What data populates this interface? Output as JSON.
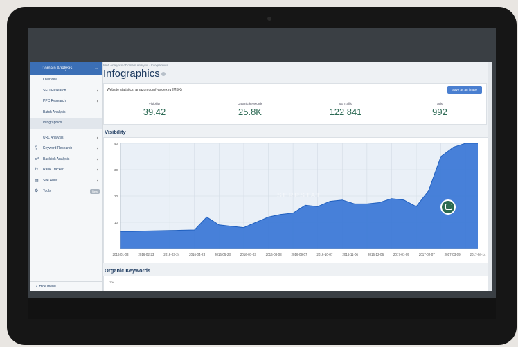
{
  "sidebar": {
    "header": "Domain Analysis",
    "items": [
      {
        "label": "Overview",
        "chevron": false,
        "active": false
      },
      {
        "label": "SEO Research",
        "chevron": true,
        "active": false
      },
      {
        "label": "PPC Research",
        "chevron": true,
        "active": false
      },
      {
        "label": "Batch Analysis",
        "chevron": false,
        "active": false
      },
      {
        "label": "Infographics",
        "chevron": false,
        "active": true
      }
    ],
    "tools": [
      {
        "label": "URL Analysis",
        "icon": "link-icon"
      },
      {
        "label": "Keyword Research",
        "icon": "key-icon"
      },
      {
        "label": "Backlink Analysis",
        "icon": "chain-icon"
      },
      {
        "label": "Rank Tracker",
        "icon": "refresh-icon"
      },
      {
        "label": "Site Audit",
        "icon": "chart-icon"
      },
      {
        "label": "Tools",
        "icon": "gear-icon",
        "badge": "New"
      }
    ],
    "hide_menu": "Hide menu"
  },
  "breadcrumb": "Web Analytics / Domain Analysis / Infographics",
  "page_title": "Infographics",
  "stats_panel": {
    "header": "Website statistics: amazon.com/yandex.ru (MSK)",
    "save_button": "Save as an image",
    "stats": [
      {
        "label": "Visibility",
        "value": "39.42"
      },
      {
        "label": "Organic keywords",
        "value": "25.8K"
      },
      {
        "label": "SE Traffic",
        "value": "122 841"
      },
      {
        "label": "Ads",
        "value": "992"
      }
    ]
  },
  "visibility_section": {
    "title": "Visibility"
  },
  "watermark": "SERPSTAT",
  "organic_section": {
    "title": "Organic Keywords",
    "tick": "70k"
  },
  "chart_data": {
    "type": "area",
    "x": [
      "2016-01-03",
      "2016-02-03",
      "2016-02-23",
      "2016-03-24",
      "2016-04-03",
      "2016-04-23",
      "2016-05-03",
      "2016-05-23",
      "2016-06-03",
      "2016-07-03",
      "2016-07-23",
      "2016-08-08",
      "2016-08-23",
      "2016-09-07",
      "2016-09-23",
      "2016-10-07",
      "2016-10-23",
      "2016-11-06",
      "2016-11-23",
      "2016-12-06",
      "2016-12-23",
      "2017-01-05",
      "2017-01-23",
      "2017-02-07",
      "2017-02-23",
      "2017-03-09",
      "2017-03-23",
      "2017-04-04",
      "2017-04-14",
      "2017-04-24"
    ],
    "x_tick_labels": [
      "2016-01-03",
      "2016-02-23",
      "2016-03-24",
      "2016-04-23",
      "2016-05-23",
      "2016-07-03",
      "2016-08-08",
      "2016-09-07",
      "2016-10-07",
      "2016-11-06",
      "2016-12-06",
      "2017-01-05",
      "2017-02-07",
      "2017-03-09",
      "2017-04-14"
    ],
    "values": [
      6.5,
      6.5,
      6.7,
      6.8,
      6.9,
      7.0,
      7.1,
      12.0,
      9.0,
      8.5,
      8.0,
      10.0,
      12.0,
      13.0,
      13.5,
      16.5,
      16.0,
      18.0,
      18.5,
      17.0,
      17.0,
      17.5,
      19.0,
      18.5,
      16.0,
      22.0,
      35.0,
      38.5,
      40.0,
      40.0
    ],
    "ylim": [
      0,
      40
    ],
    "y_ticks": [
      10,
      20,
      30,
      40
    ],
    "grid": true,
    "color": "#3876d6"
  }
}
